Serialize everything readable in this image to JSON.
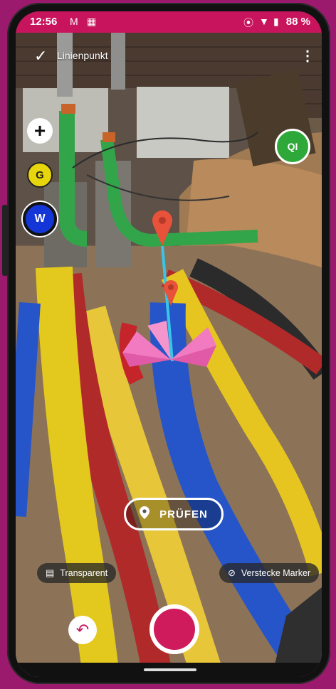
{
  "status": {
    "time": "12:56",
    "left_icons": [
      "gmail-icon",
      "calendar-icon"
    ],
    "right_icons": [
      "location-icon",
      "wifi-icon",
      "battery-icon"
    ],
    "battery": "88 %"
  },
  "header": {
    "title": "Linienpunkt",
    "confirm_icon": "check-icon",
    "menu_icon": "more-vert-icon"
  },
  "layer_buttons": {
    "add_label": "+",
    "g_label": "G",
    "w_label": "W",
    "ql_label": "QI"
  },
  "colors": {
    "accent": "#c8145c",
    "g_button": "#e8d60c",
    "w_button": "#1536d6",
    "ql_button": "#2fa83a",
    "marker": "#e8513a",
    "line": "#38c6e8",
    "arrow": "#f27ac0"
  },
  "check_button": {
    "label": "PRÜFEN",
    "icon": "location-pin-icon"
  },
  "toggles": {
    "transparent_label": "Transparent",
    "transparent_icon": "texture-icon",
    "hide_markers_label": "Verstecke Marker",
    "hide_markers_icon": "location-off-icon"
  },
  "bottom": {
    "undo_icon": "undo-icon",
    "shutter_icon": "record-button"
  }
}
